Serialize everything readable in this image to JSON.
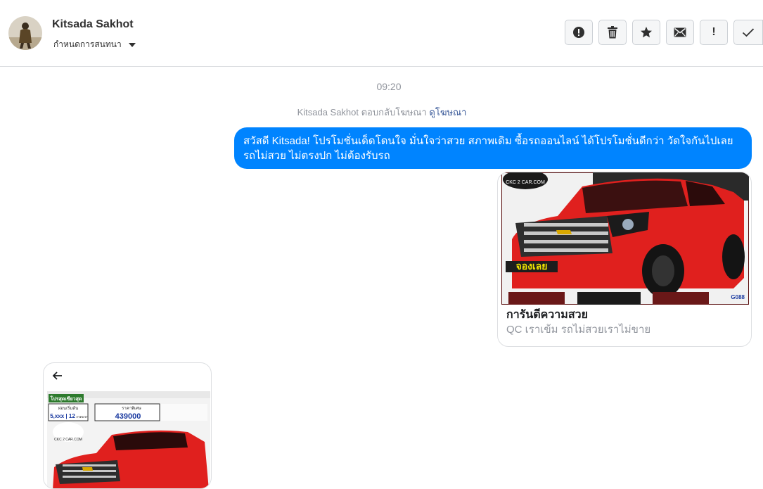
{
  "header": {
    "name": "Kitsada Sakhot",
    "convo_setting": "กำหนดการสนทนา",
    "actions": [
      {
        "icon": "alert-circle-icon",
        "label": "Mark as spam"
      },
      {
        "icon": "trash-icon",
        "label": "Delete"
      },
      {
        "icon": "star-icon",
        "label": "Star"
      },
      {
        "icon": "envelope-icon",
        "label": "Mark unread"
      },
      {
        "icon": "exclamation-icon",
        "label": "!"
      },
      {
        "icon": "check-icon",
        "label": "Done"
      }
    ]
  },
  "thread": {
    "time": "09:20",
    "reply_prefix": "Kitsada Sakhot ตอบกลับโฆษณา",
    "reply_link": "ดูโฆษณา",
    "message_line1": "สวัสดี Kitsada! โปรโมชั่นเด็ดโดนใจ มั่นใจว่าสวย สภาพเดิม ซื้อรถออนไลน์ ได้โปรโมชั่นดีกว่า วัดใจกันไปเลย",
    "message_line2": "รถไม่สวย ไม่ตรงปก ไม่ต้องรับรถ",
    "card": {
      "title": "การันตีความสวย",
      "subtitle": "QC เราเข้ม รถไม่สวยเราไม่ขาย",
      "image_logo_text": "CKC 2 CAR.COM",
      "image_badge": "จองเลย",
      "image_code": "G088"
    },
    "card2": {
      "promo_title": "โปรสุดเขียวสุด",
      "down_label": "ผ่อนเริ่มต้น",
      "down_value": "5,xxx | 12",
      "down_unit": "งวดแรก",
      "price_label": "ราคาพิเศษ",
      "price_value": "439000",
      "logo_text": "CKC 2 CAR.COM"
    }
  },
  "colors": {
    "accent": "#0084ff",
    "link": "#385898",
    "muted": "#90949c",
    "car_red": "#e0201e"
  }
}
